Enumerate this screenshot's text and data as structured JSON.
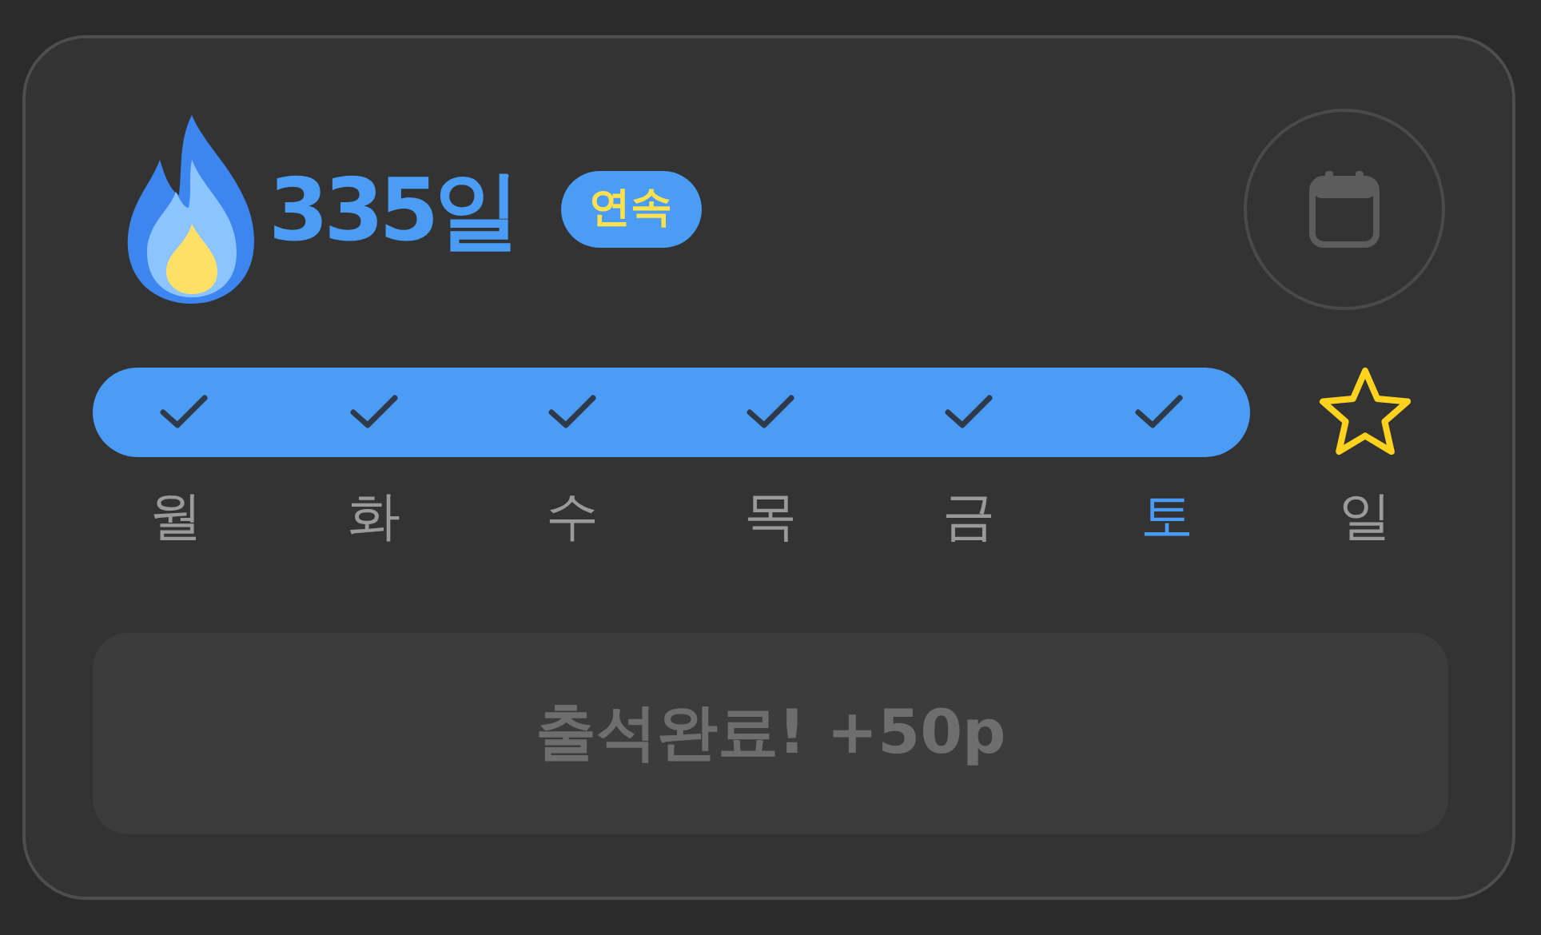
{
  "streak": {
    "count": "335일",
    "badge": "연속"
  },
  "days": [
    {
      "label": "월",
      "kind": "check",
      "checked": true,
      "today": false
    },
    {
      "label": "화",
      "kind": "check",
      "checked": true,
      "today": false
    },
    {
      "label": "수",
      "kind": "check",
      "checked": true,
      "today": false
    },
    {
      "label": "목",
      "kind": "check",
      "checked": true,
      "today": false
    },
    {
      "label": "금",
      "kind": "check",
      "checked": true,
      "today": false
    },
    {
      "label": "토",
      "kind": "check",
      "checked": true,
      "today": true
    },
    {
      "label": "일",
      "kind": "star",
      "checked": false,
      "today": false
    }
  ],
  "button": {
    "label": "출석완료! +50p",
    "disabled": true
  }
}
